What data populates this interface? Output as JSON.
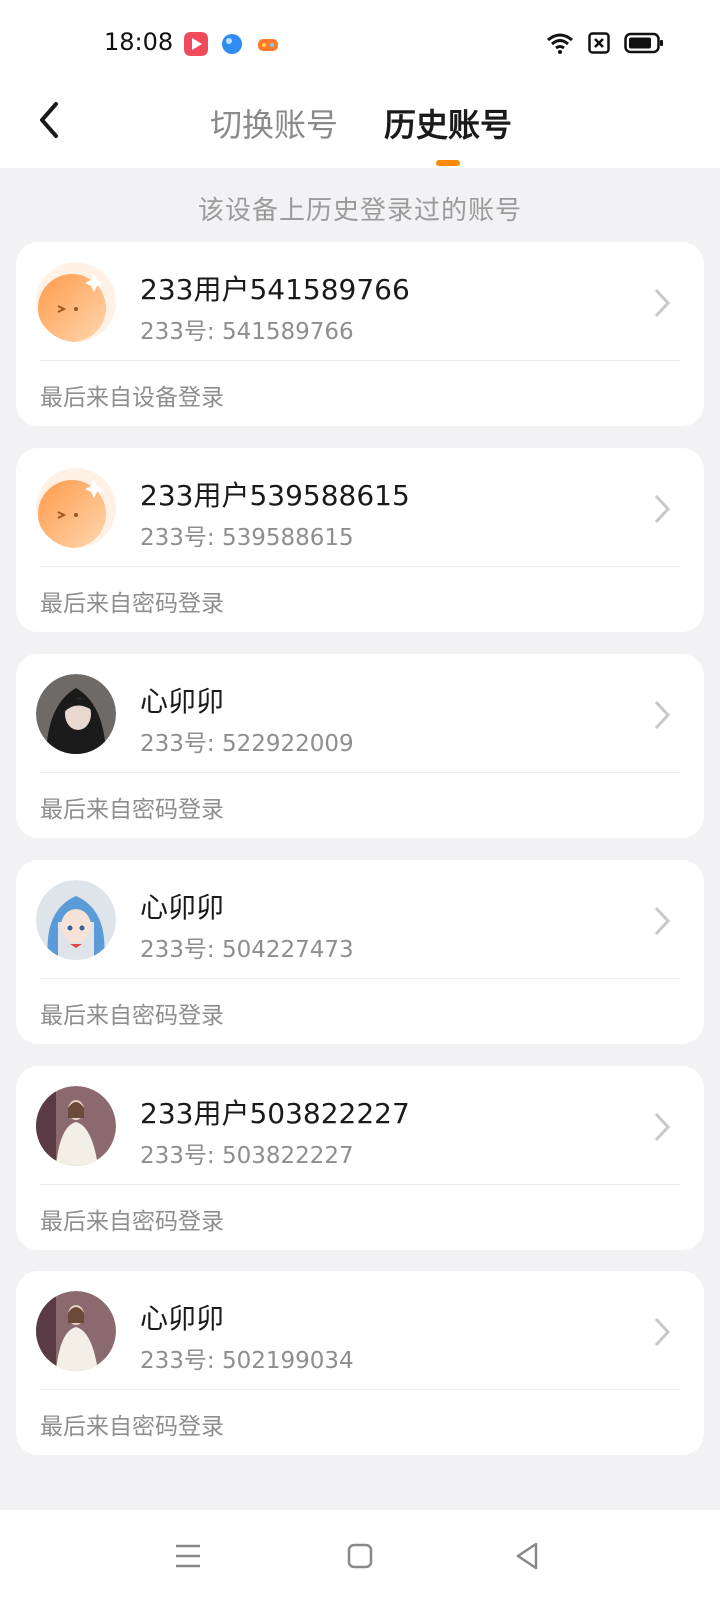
{
  "status_bar": {
    "time": "18:08",
    "app_icons": [
      {
        "name": "video-app-icon",
        "color": "#ef4b5c"
      },
      {
        "name": "browser-app-icon",
        "color": "#2f8cf0"
      },
      {
        "name": "game-app-icon",
        "color": "#ff7a2e"
      }
    ],
    "icons": [
      "wifi-icon",
      "sim-off-icon",
      "battery-icon"
    ]
  },
  "header": {
    "back_icon": "back-arrow-icon",
    "tabs": [
      {
        "label": "切换账号",
        "active": false
      },
      {
        "label": "历史账号",
        "active": true
      }
    ],
    "accent_color": "#ff8a00"
  },
  "subtitle": "该设备上历史登录过的账号",
  "accounts": [
    {
      "name": "233用户541589766",
      "uid": "233号: 541589766",
      "login_source": "最后来自设备登录",
      "avatar": "default-mascot"
    },
    {
      "name": "233用户539588615",
      "uid": "233号: 539588615",
      "login_source": "最后来自密码登录",
      "avatar": "default-mascot"
    },
    {
      "name": "心卯卯",
      "uid": "233号: 522922009",
      "login_source": "最后来自密码登录",
      "avatar": "dark-hair-photo"
    },
    {
      "name": "心卯卯",
      "uid": "233号: 504227473",
      "login_source": "最后来自密码登录",
      "avatar": "blue-hair-anime"
    },
    {
      "name": "233用户503822227",
      "uid": "233号: 503822227",
      "login_source": "最后来自密码登录",
      "avatar": "white-dress-photo"
    },
    {
      "name": "心卯卯",
      "uid": "233号: 502199034",
      "login_source": "最后来自密码登录",
      "avatar": "white-dress-photo"
    }
  ],
  "nav_bar": {
    "icons": [
      "menu-icon",
      "home-square-icon",
      "back-triangle-icon"
    ]
  }
}
